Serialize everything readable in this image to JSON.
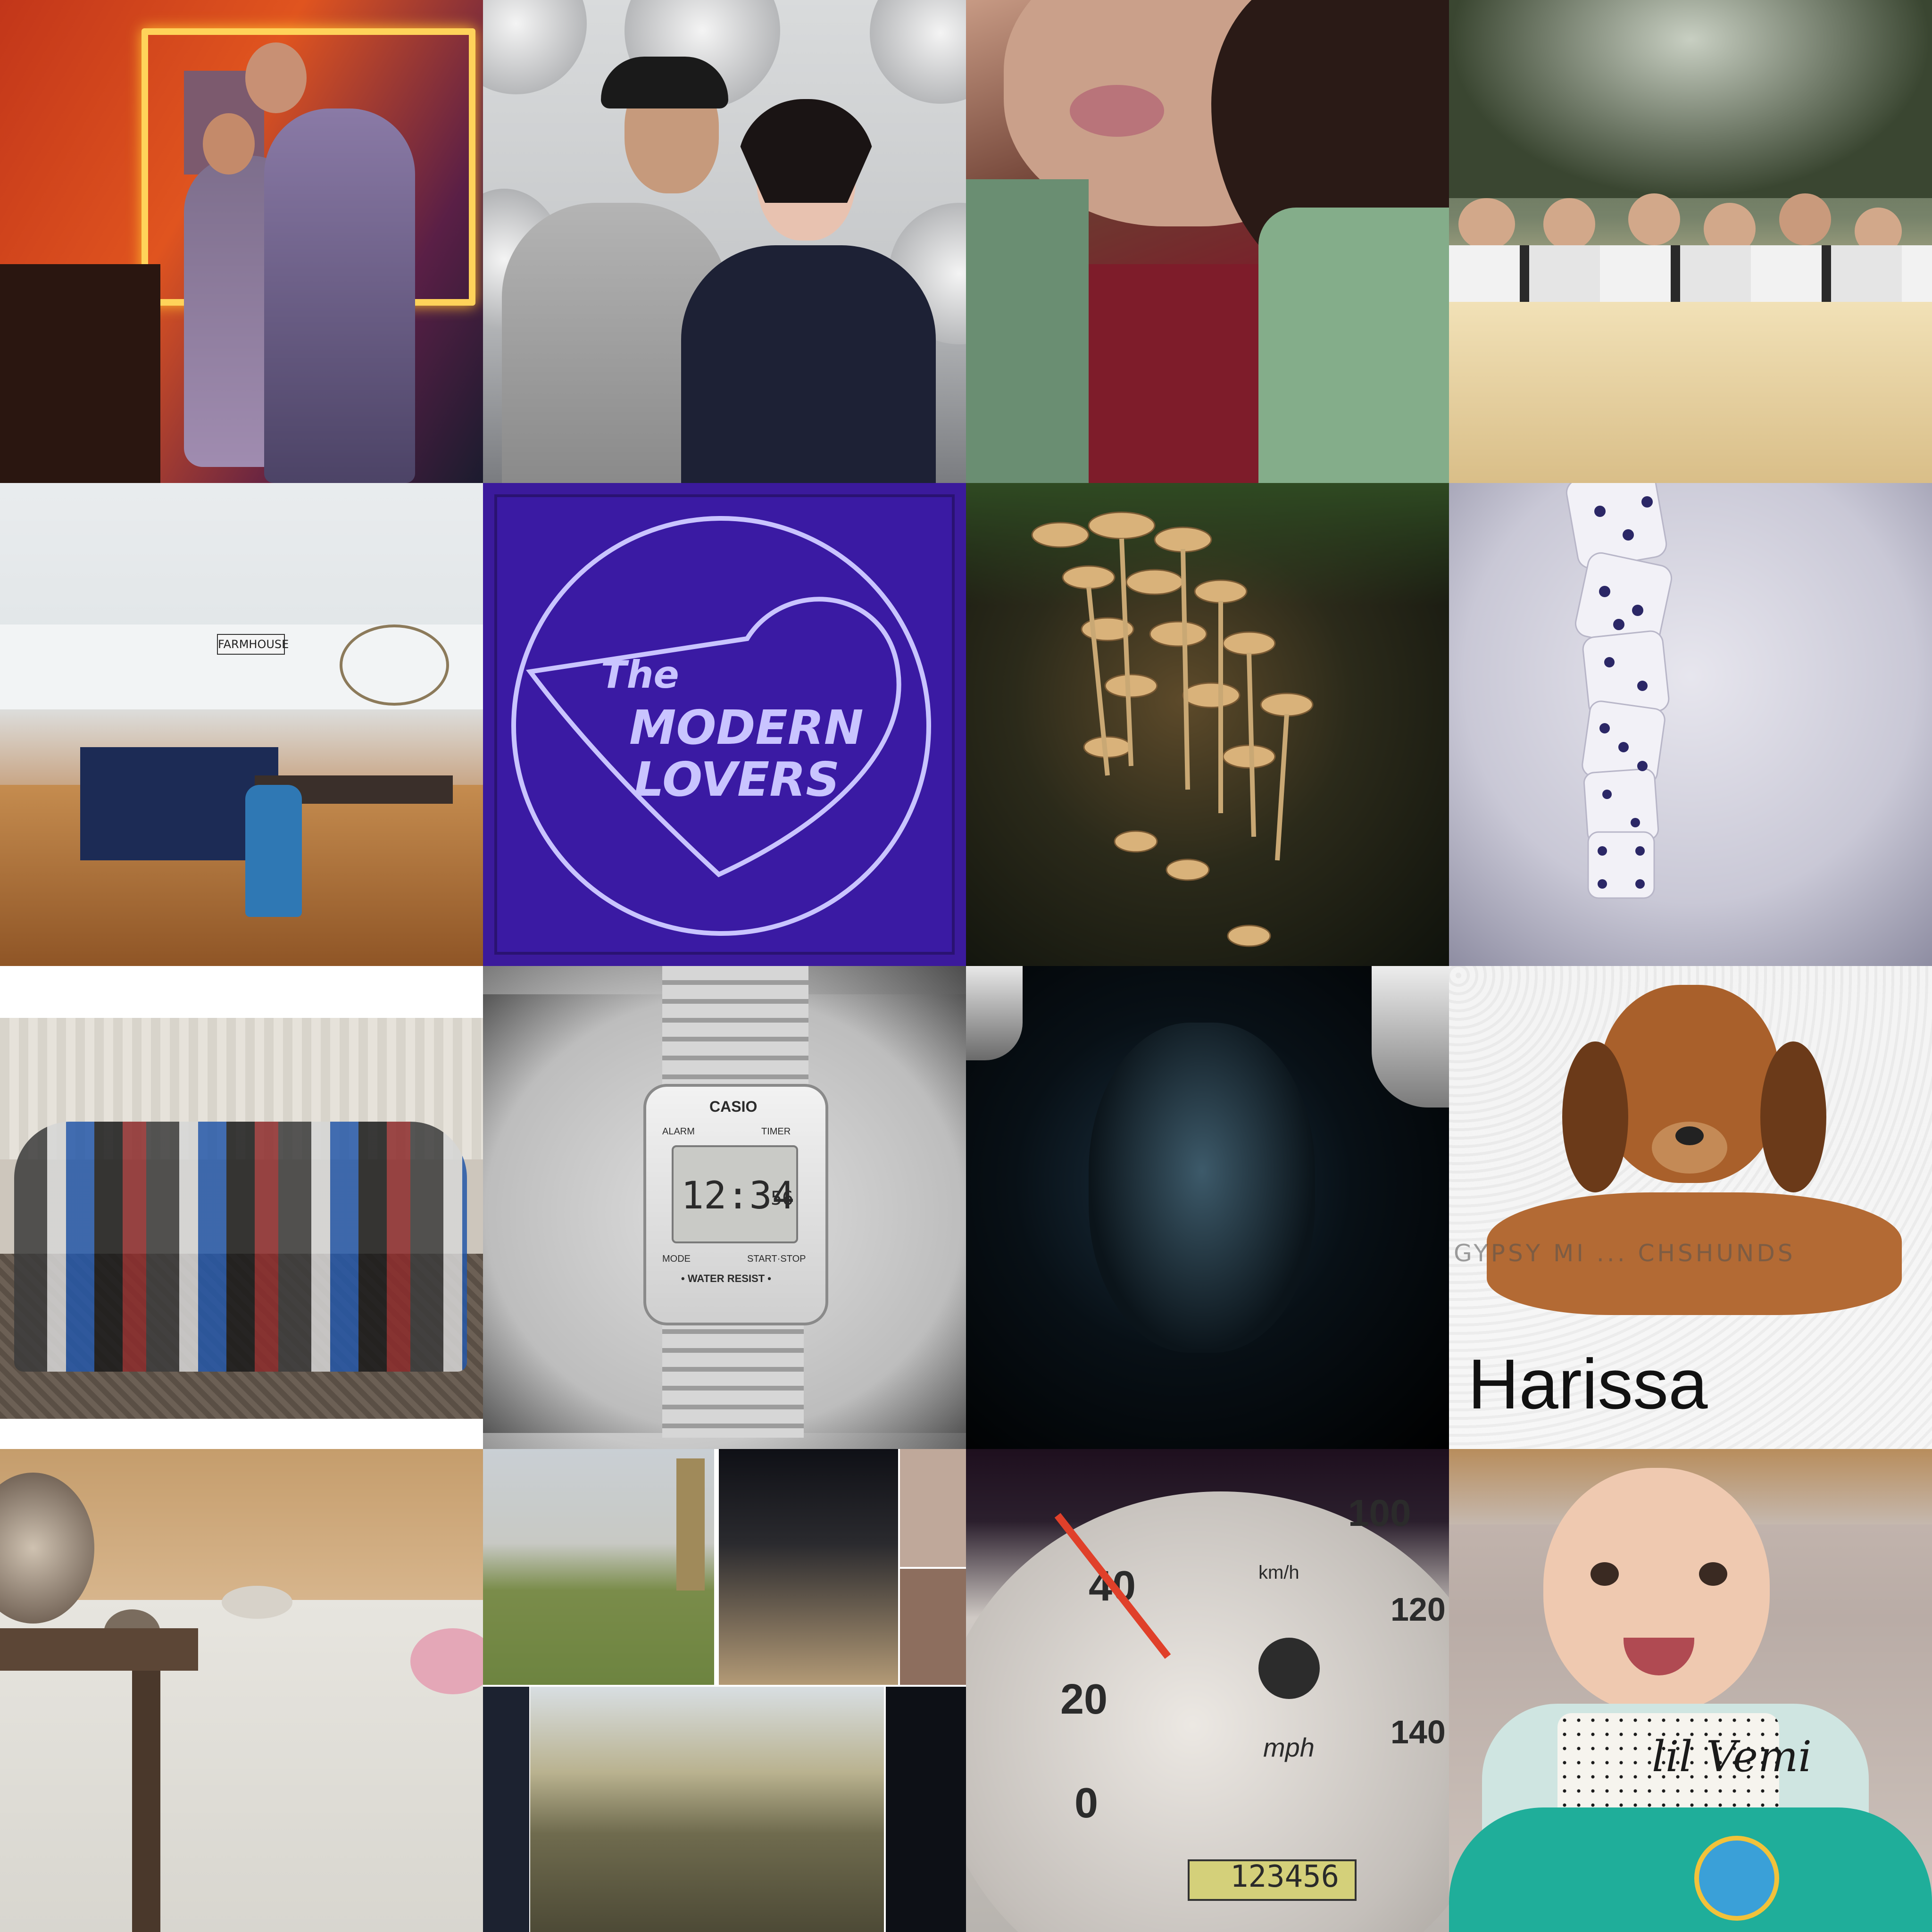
{
  "tiles": [
    {
      "id": "party-couple"
    },
    {
      "id": "museum-couple"
    },
    {
      "id": "selfie"
    },
    {
      "id": "kids-at-railing"
    },
    {
      "id": "kitchen",
      "sign": "FARMHOUSE"
    },
    {
      "id": "album-cover",
      "line1": "The",
      "line2": "MODERN",
      "line3": "LOVERS"
    },
    {
      "id": "mushrooms"
    },
    {
      "id": "dice-tower"
    },
    {
      "id": "group-photo"
    },
    {
      "id": "watch",
      "brand": "CASIO",
      "label_alarm": "ALARM",
      "label_timer": "TIMER",
      "time": "12:34",
      "seconds": "56",
      "label_mode": "MODE",
      "label_startstop": "START·STOP",
      "label_water": "• WATER RESIST •"
    },
    {
      "id": "dark-portrait"
    },
    {
      "id": "puppy",
      "watermark": "GYPSY MI ... CHSHUNDS",
      "name": "Harissa"
    },
    {
      "id": "cats"
    },
    {
      "id": "travel-collage"
    },
    {
      "id": "speedometer",
      "n40": "40",
      "n20": "20",
      "n0": "0",
      "n100": "100",
      "n120": "120",
      "n140": "140",
      "unit_mph": "mph",
      "unit_kmh": "km/h",
      "odometer": "123456"
    },
    {
      "id": "baby",
      "bib_text": "lil Vemi"
    }
  ]
}
